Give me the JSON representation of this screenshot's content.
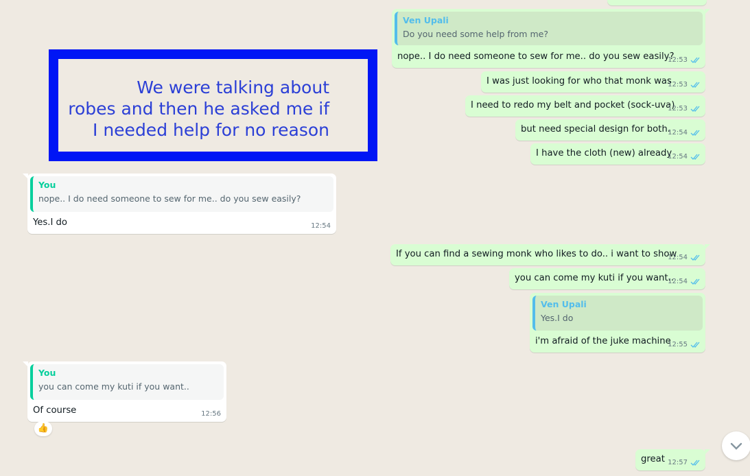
{
  "annotation": {
    "line1": "We were talking about",
    "line2": "robes and then he asked me if",
    "line3": "I needed help for no reason"
  },
  "messages": [
    {
      "dir": "out",
      "quote_name": "Ven Upali",
      "quote_text": "Do you need some help from me?",
      "text": "nope..   I do need someone to sew for me.. do you sew easily?",
      "time": "12:53"
    },
    {
      "dir": "out",
      "text": "I was just looking for who that monk was",
      "time": "12:53"
    },
    {
      "dir": "out",
      "text": "I need to redo my belt and pocket (sock-uva)",
      "time": "12:53"
    },
    {
      "dir": "out",
      "text": "but need special design for both.",
      "time": "12:54"
    },
    {
      "dir": "out",
      "text": "I have the cloth (new) already",
      "time": "12:54"
    },
    {
      "dir": "in",
      "quote_name": "You",
      "quote_text": "nope..   I do need someone to sew for me.. do you sew easily?",
      "text": "Yes.I do",
      "time": "12:54"
    },
    {
      "dir": "out",
      "text": "If you can find a sewing monk who likes to do.. i want to show",
      "time": "12:54"
    },
    {
      "dir": "out",
      "text": "you can come my kuti if you want..",
      "time": "12:54"
    },
    {
      "dir": "out",
      "quote_name": "Ven Upali",
      "quote_text": "Yes.I do",
      "text": "i'm afraid of the juke machine",
      "time": "12:55"
    },
    {
      "dir": "in",
      "quote_name": "You",
      "quote_text": "you can come my kuti if you want..",
      "text": "Of course",
      "time": "12:56",
      "reaction": "👍"
    },
    {
      "dir": "out",
      "text": "great",
      "time": "12:57"
    }
  ],
  "colors": {
    "outgoing_bubble": "#d9fdd3",
    "incoming_bubble": "#ffffff",
    "read_ticks": "#53bdeb",
    "annotation_border": "#0016f5",
    "annotation_text": "#2b3fd6"
  },
  "icons": {
    "ticks": "double-check-icon",
    "scroll": "chevron-down-icon"
  }
}
